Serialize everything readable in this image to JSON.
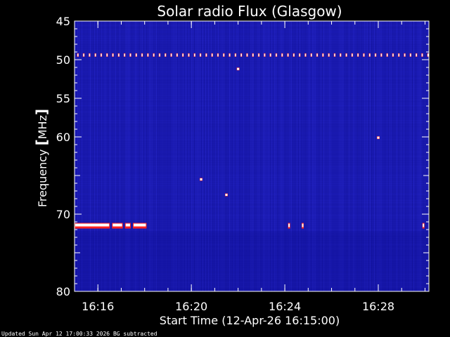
{
  "chart_data": {
    "type": "heatmap",
    "title": "Solar radio Flux (Glasgow)",
    "ylabel_prefix": "Frequency ",
    "ylabel_unit": "MHz",
    "xlabel": "Start Time (12-Apr-26 16:15:00)",
    "footer": "Updated Sun Apr 12 17:00:33 2026   BG subtracted",
    "y_axis": {
      "reversed": true,
      "range": [
        45,
        80
      ],
      "major_ticks": [
        45,
        50,
        55,
        60,
        70,
        80
      ],
      "tick_labels": [
        "45",
        "50",
        "55",
        "60",
        "70",
        "80"
      ]
    },
    "x_axis": {
      "range": [
        "16:15:00",
        "16:30:10"
      ],
      "major_ticks": [
        "16:16",
        "16:20",
        "16:24",
        "16:28"
      ],
      "tick_labels": [
        "16:16",
        "16:20",
        "16:24",
        "16:28"
      ]
    },
    "colors": {
      "background": "#1a1ab0",
      "emission": "#ffffff",
      "emission_edge": "#ff2020",
      "frame": "#ffffff"
    },
    "emission_bands": [
      {
        "freq_mhz": 49.4,
        "time_start": "16:15:00",
        "time_end": "16:30:10",
        "pattern": "dashed"
      },
      {
        "freq_mhz": 71.5,
        "time_start": "16:15:00",
        "time_end": "16:18:05",
        "pattern": "segments"
      },
      {
        "freq_mhz": 71.5,
        "time_start": "16:24:10",
        "time_end": "16:24:45",
        "pattern": "dots"
      },
      {
        "freq_mhz": 71.5,
        "time_start": "16:29:55",
        "time_end": "16:30:05",
        "pattern": "dots"
      }
    ],
    "spots": [
      {
        "time": "16:22:00",
        "freq_mhz": 51.2
      },
      {
        "time": "16:28:00",
        "freq_mhz": 60.1
      },
      {
        "time": "16:21:30",
        "freq_mhz": 67.5
      },
      {
        "time": "16:20:25",
        "freq_mhz": 65.5
      }
    ]
  }
}
